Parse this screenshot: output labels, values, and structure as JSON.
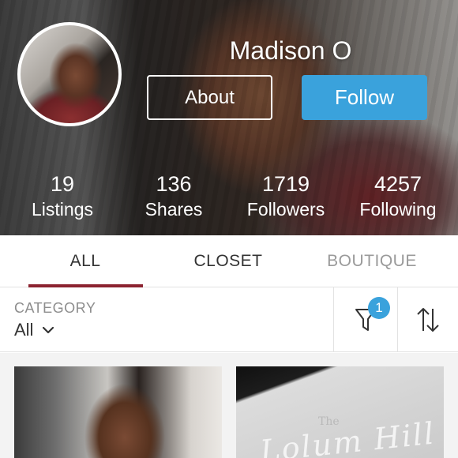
{
  "profile": {
    "name": "Madison O",
    "about_label": "About",
    "follow_label": "Follow"
  },
  "stats": [
    {
      "value": "19",
      "label": "Listings"
    },
    {
      "value": "136",
      "label": "Shares"
    },
    {
      "value": "1719",
      "label": "Followers"
    },
    {
      "value": "4257",
      "label": "Following"
    }
  ],
  "tabs": [
    {
      "label": "ALL",
      "active": true
    },
    {
      "label": "CLOSET",
      "active": false
    },
    {
      "label": "BOUTIQUE",
      "active": false
    }
  ],
  "filter": {
    "category_label": "CATEGORY",
    "category_value": "All",
    "filter_badge_count": "1"
  },
  "listings": [
    {
      "caption": "",
      "script": ""
    },
    {
      "caption": "The",
      "script": "Lolum Hill"
    }
  ],
  "colors": {
    "follow_blue": "#3aa2dc",
    "tab_underline": "#8c2330",
    "inactive_tab": "#9a9a9a",
    "badge": "#3aa2dc"
  },
  "icons": [
    "chevron-down-icon",
    "filter-funnel-icon",
    "sort-arrows-icon"
  ]
}
